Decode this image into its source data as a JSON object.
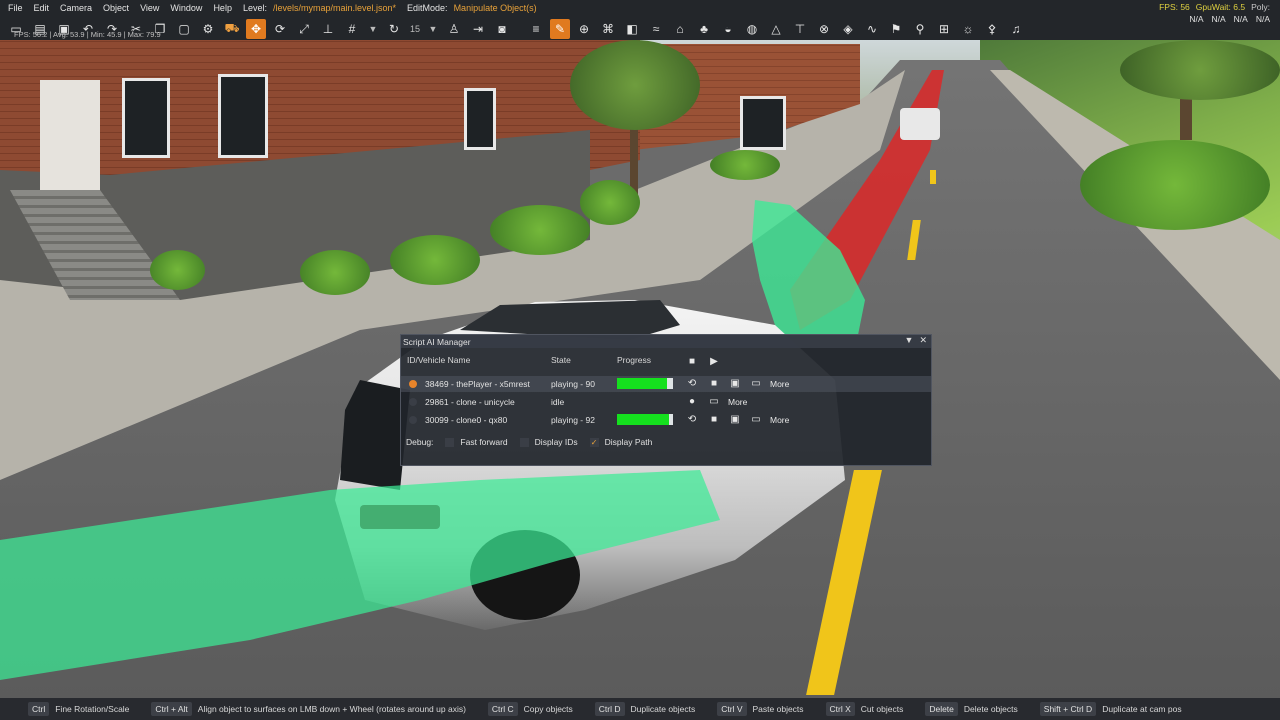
{
  "menu": {
    "items": [
      "File",
      "Edit",
      "Camera",
      "Object",
      "View",
      "Window",
      "Help"
    ],
    "level_label": "Level:",
    "level_path": "/levels/mymap/main.level.json*",
    "editmode_label": "EditMode:",
    "editmode_value": "Manipulate Object(s)"
  },
  "stats": {
    "fps": "FPS: 56",
    "gpuwait": "GpuWait: 6.5",
    "poly": "Poly:",
    "na1": "N/A",
    "na2": "N/A",
    "na3": "N/A",
    "na4": "N/A",
    "fps_line": "FPS: 56.2 | Avg: 53.9 | Min: 45.9 | Max: 79.9"
  },
  "toolbar": {
    "snap_value": "15",
    "icons": [
      "file-new-icon",
      "folder-open-icon",
      "save-icon",
      "undo-icon",
      "redo-icon",
      "cut-icon",
      "copy-icon",
      "paste-icon",
      "gear-icon",
      "vehicle-icon",
      "move-icon",
      "rotate-icon",
      "scale-icon",
      "snap-icon",
      "grid-icon",
      "camera-icon",
      "menu-icon",
      "pencil-icon",
      "plus-circle-icon",
      "road-icon",
      "decal-icon",
      "river-icon",
      "building-icon",
      "forest-icon",
      "terrain-icon",
      "paint-icon",
      "mesh-icon",
      "sign-icon",
      "node-icon",
      "layers-icon",
      "spline-icon",
      "flag-icon",
      "spawn-icon",
      "traffic-icon",
      "light-icon",
      "pin-icon",
      "sound-icon"
    ]
  },
  "panel": {
    "title": "Script AI Manager",
    "col_id": "ID/Vehicle Name",
    "col_state": "State",
    "col_progress": "Progress",
    "rows": [
      {
        "name": "38469 - thePlayer - x5mrest",
        "state": "playing - 90",
        "progress": 0.9,
        "active": true,
        "more": "More"
      },
      {
        "name": "29861 - clone - unicycle",
        "state": "idle",
        "progress": null,
        "active": false,
        "more": "More"
      },
      {
        "name": "30099 - clone0 - qx80",
        "state": "playing - 92",
        "progress": 0.92,
        "active": false,
        "more": "More"
      }
    ],
    "debug_label": "Debug:",
    "opt_fast_forward": "Fast forward",
    "opt_display_ids": "Display IDs",
    "opt_display_path": "Display Path",
    "display_path_checked": true
  },
  "status": {
    "hints": [
      {
        "key": "Ctrl",
        "desc": "Fine Rotation/Scale"
      },
      {
        "key": "Ctrl + Alt",
        "desc": "Align object to surfaces on LMB down + Wheel (rotates around up axis)"
      },
      {
        "key": "Ctrl C",
        "desc": "Copy objects"
      },
      {
        "key": "Ctrl D",
        "desc": "Duplicate objects"
      },
      {
        "key": "Ctrl V",
        "desc": "Paste objects"
      },
      {
        "key": "Ctrl X",
        "desc": "Cut objects"
      },
      {
        "key": "Delete",
        "desc": "Delete objects"
      },
      {
        "key": "Shift + Ctrl D",
        "desc": "Duplicate at cam pos"
      }
    ]
  },
  "colors": {
    "accent": "#e07a1f",
    "progress_fill": "#15e01e",
    "path_green": "#3ceb96",
    "path_red": "#dc2828"
  }
}
